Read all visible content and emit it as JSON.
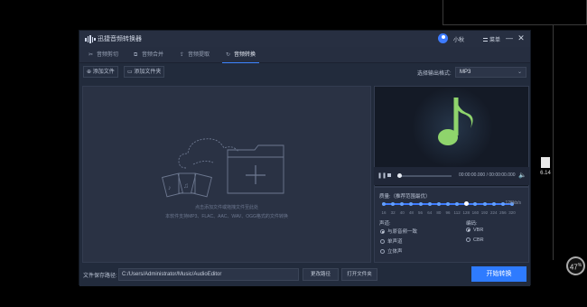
{
  "desktop": {
    "file_label": "6.14",
    "badge_value": "47",
    "badge_unit": "%"
  },
  "app": {
    "title": "迅捷音频转换器",
    "username": "小秋",
    "menu_label": "菜单"
  },
  "tabs": [
    {
      "label": "音频剪切",
      "icon": "scissors-icon"
    },
    {
      "label": "音频合并",
      "icon": "merge-icon"
    },
    {
      "label": "音频提取",
      "icon": "extract-icon"
    },
    {
      "label": "音频转换",
      "icon": "convert-icon",
      "active": true
    }
  ],
  "toolbar": {
    "add_file": "添加文件",
    "add_folder": "添加文件夹",
    "format_label": "选择输出格式:",
    "format_value": "MP3"
  },
  "droparea": {
    "hint": "点击添加文件或拖拽文件至此处",
    "support": "本软件支持MP3、FLAC、AAC、WAV、OGG格式的文件转换"
  },
  "player": {
    "time": "00:00:00.000 / 00:00:00.000"
  },
  "settings": {
    "quality_label": "质量:（推荐范围最优）",
    "quality_value": "128kb/s",
    "bitrate_ticks": [
      "16",
      "32",
      "40",
      "48",
      "56",
      "64",
      "80",
      "96",
      "112",
      "128",
      "160",
      "192",
      "224",
      "256",
      "320"
    ],
    "selected_bitrate": "128",
    "channel_label": "声道:",
    "channel_options": [
      "与原音频一致",
      "单声道",
      "立体声"
    ],
    "channel_selected": 0,
    "encoding_label": "编码:",
    "encoding_options": [
      "VBR",
      "CBR"
    ],
    "encoding_selected": 0
  },
  "bottom": {
    "save_label": "文件保存路径:",
    "save_path": "C:/Users/Administrator/Music/AudioEditor",
    "change_path": "更改路径",
    "open_folder": "打开文件夹",
    "start": "开始转换"
  },
  "colors": {
    "accent": "#2e7bff",
    "music_note": "#8fd46c"
  }
}
